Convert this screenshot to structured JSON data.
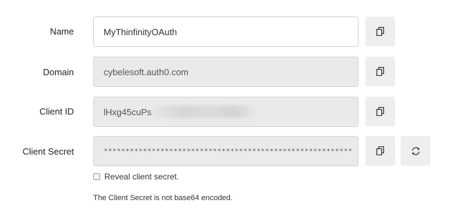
{
  "form": {
    "name": {
      "label": "Name",
      "value": "MyThinfinityOAuth"
    },
    "domain": {
      "label": "Domain",
      "value": "cybelesoft.auth0.com"
    },
    "client_id": {
      "label": "Client ID",
      "value": "lHxg45cuPs"
    },
    "client_secret": {
      "label": "Client Secret",
      "value": "*********************************************************"
    },
    "reveal": {
      "label": "Reveal client secret.",
      "checked": false
    },
    "note": "The Client Secret is not base64 encoded."
  },
  "icons": {
    "copy": "copy-icon",
    "rotate": "rotate-icon"
  },
  "colors": {
    "readonly_bg": "#eaeaea",
    "button_bg": "#eeeeee",
    "border": "#cfcfcf",
    "text": "#222222"
  }
}
